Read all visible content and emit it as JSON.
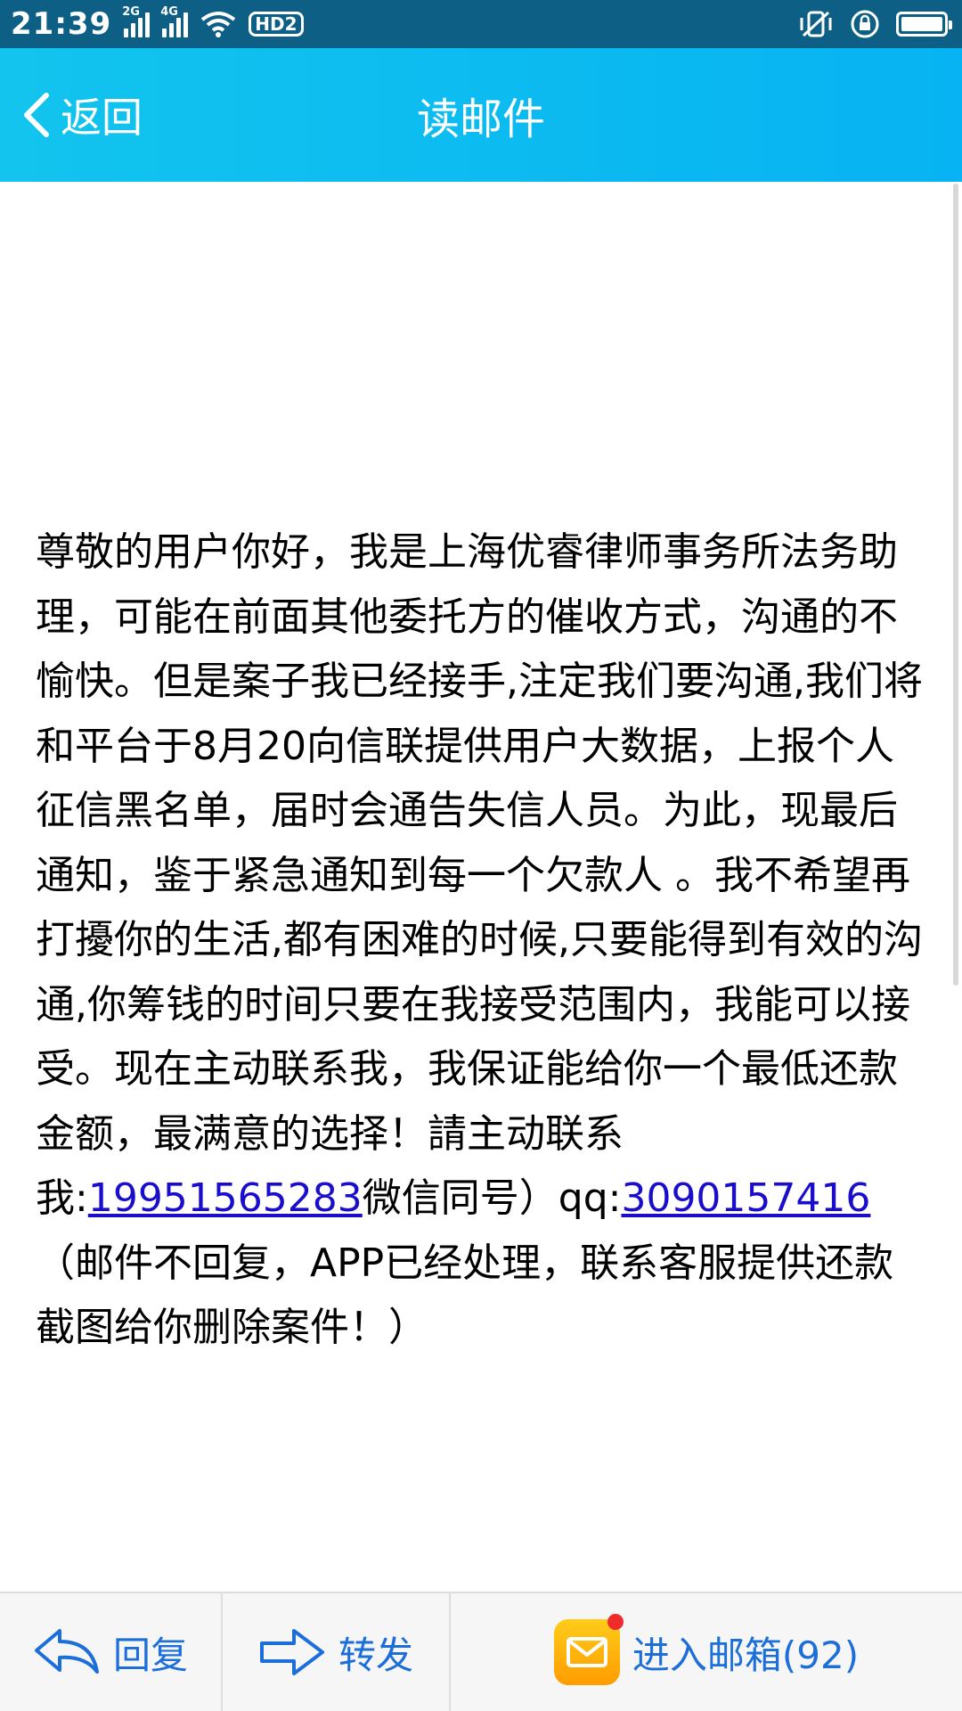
{
  "status_bar": {
    "time": "21:39",
    "signal1_tag": "2G",
    "signal2_tag": "4G",
    "hd_label": "HD2"
  },
  "header": {
    "back_label": "返回",
    "title": "读邮件"
  },
  "mail": {
    "body_part1": "尊敬的用户你好，我是上海优睿律师事务所法务助理，可能在前面其他委托方的催收方式，沟通的不愉快。但是案子我已经接手,注定我们要沟通,我们将和平台于8月20向信联提供用户大数据，上报个人征信黑名单，届时会通告失信人员。为此，现最后通知，鉴于紧急通知到每一个欠款人 。我不希望再打擾你的生活,都有困难的时候,只要能得到有效的沟通,你筹钱的时间只要在我接受范围内，我能可以接受。现在主动联系我，我保证能给你一个最低还款金额，最满意的选择！請主动联系我:",
    "phone_link": "19951565283",
    "body_part2": "微信同号）qq:",
    "qq_link": "3090157416",
    "body_part3": "（邮件不回复，APP已经处理，联系客服提供还款截图给你删除案件！）"
  },
  "toolbar": {
    "reply_label": "回复",
    "forward_label": "转发",
    "inbox_label": "进入邮箱(92)"
  },
  "colors": {
    "status_bar_bg": "#0d5f86",
    "header_bg": "#12c4ee",
    "link": "#1a0dcc",
    "toolbar_text": "#1c6fd8",
    "inbox_icon": "#ffb000"
  }
}
